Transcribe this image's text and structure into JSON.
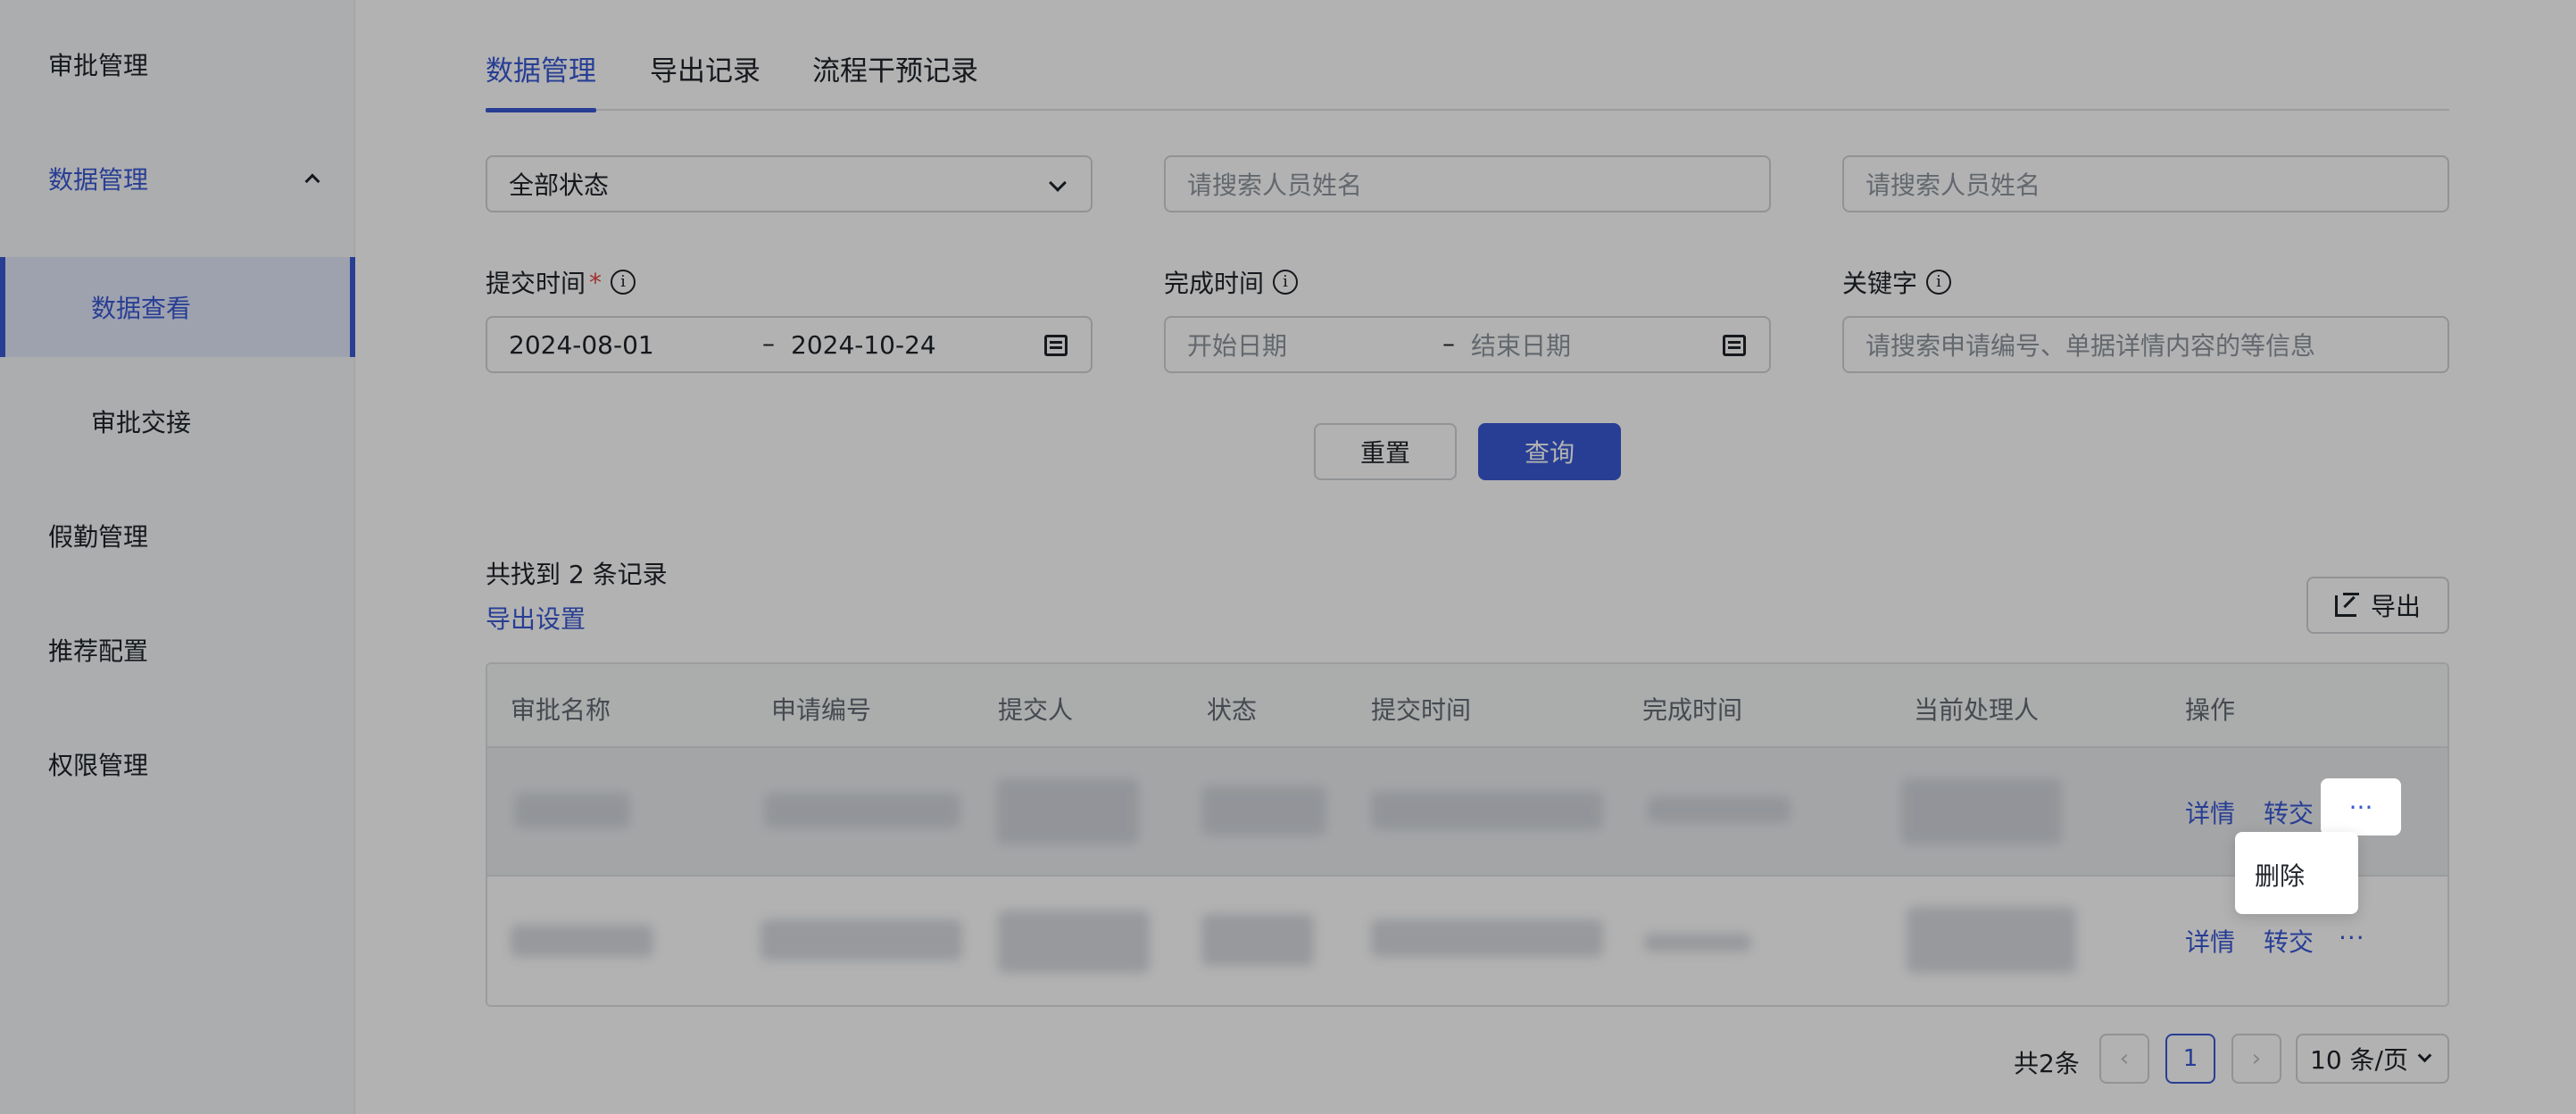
{
  "sidebar": {
    "items": [
      {
        "label": "审批管理"
      },
      {
        "label": "数据管理"
      },
      {
        "label": "数据查看"
      },
      {
        "label": "审批交接"
      },
      {
        "label": "假勤管理"
      },
      {
        "label": "推荐配置"
      },
      {
        "label": "权限管理"
      }
    ]
  },
  "tabs": [
    {
      "label": "数据管理"
    },
    {
      "label": "导出记录"
    },
    {
      "label": "流程干预记录"
    }
  ],
  "filters": {
    "status_value": "全部状态",
    "person_placeholder_1": "请搜索人员姓名",
    "person_placeholder_2": "请搜索人员姓名",
    "submit_time_label": "提交时间",
    "submit_time_required": "*",
    "submit_start": "2024-08-01",
    "submit_end": "2024-10-24",
    "complete_time_label": "完成时间",
    "complete_start_placeholder": "开始日期",
    "complete_end_placeholder": "结束日期",
    "keyword_label": "关键字",
    "keyword_placeholder": "请搜索申请编号、单据详情内容的等信息",
    "range_sep": "–",
    "info_glyph": "i"
  },
  "actions": {
    "reset": "重置",
    "query": "查询",
    "export": "导出",
    "export_settings": "导出设置"
  },
  "result_count": "共找到 2 条记录",
  "table": {
    "columns": [
      "审批名称",
      "申请编号",
      "提交人",
      "状态",
      "提交时间",
      "完成时间",
      "当前处理人",
      "操作"
    ],
    "rows": [
      {
        "detail": "详情",
        "transfer": "转交",
        "more": "···"
      },
      {
        "detail": "详情",
        "transfer": "转交",
        "more": "···"
      }
    ]
  },
  "dropdown": {
    "items": [
      "删除"
    ]
  },
  "pagination": {
    "total": "共2条",
    "prev": "‹",
    "current": "1",
    "next": "›",
    "page_size": "10 条/页"
  },
  "colors": {
    "accent": "#3a5ad4",
    "danger": "#e54545"
  }
}
